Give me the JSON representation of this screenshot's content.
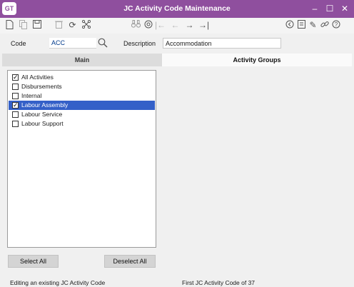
{
  "window": {
    "logo": "GT",
    "title": "JC Activity Code Maintenance",
    "controls": {
      "minimize": "–",
      "maximize": "☐",
      "close": "✕"
    }
  },
  "toolbar": {
    "left_icons": [
      "new-document-icon",
      "copy-document-icon",
      "save-icon",
      "delete-icon",
      "refresh-icon",
      "tree-icon"
    ],
    "nav_icons": [
      "binoculars-icon",
      "zoom-icon",
      "first-record-icon",
      "previous-record-icon",
      "next-record-icon",
      "last-record-icon"
    ],
    "right_icons": [
      "back-icon",
      "notes-icon",
      "edit-icon",
      "link-icon",
      "help-icon"
    ]
  },
  "fields": {
    "code_label": "Code",
    "code_value": "ACC",
    "description_label": "Description",
    "description_value": "Accommodation"
  },
  "tabs": {
    "main": "Main",
    "activity_groups": "Activity Groups"
  },
  "activities": [
    {
      "label": "All Activities",
      "checked": true,
      "selected": false
    },
    {
      "label": "Disbursements",
      "checked": false,
      "selected": false
    },
    {
      "label": "Internal",
      "checked": false,
      "selected": false
    },
    {
      "label": "Labour Assembly",
      "checked": true,
      "selected": true
    },
    {
      "label": "Labour Service",
      "checked": false,
      "selected": false
    },
    {
      "label": "Labour Support",
      "checked": false,
      "selected": false
    }
  ],
  "buttons": {
    "select_all": "Select All",
    "deselect_all": "Deselect All"
  },
  "status": {
    "left": "Editing an existing JC Activity Code",
    "right": "First JC Activity Code of 37"
  },
  "colors": {
    "titlebar": "#8f4f9e",
    "selection": "#3460c8"
  }
}
